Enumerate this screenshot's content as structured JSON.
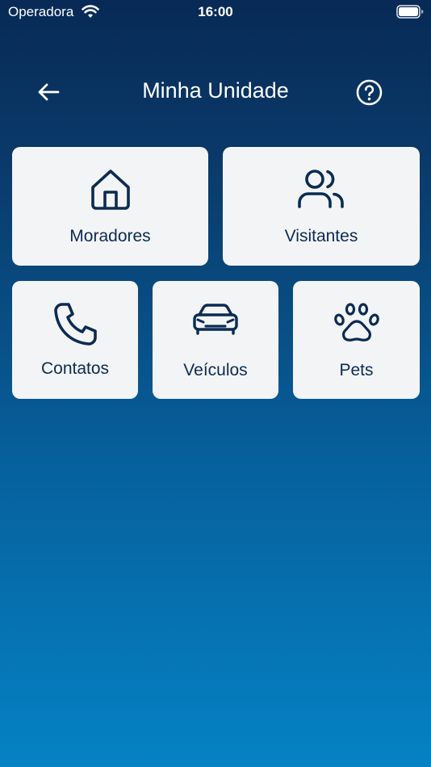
{
  "status_bar": {
    "carrier": "Operadora",
    "time": "16:00",
    "wifi_icon": "wifi-icon",
    "battery_icon": "battery-icon"
  },
  "header": {
    "title": "Minha Unidade",
    "back_icon": "arrow-left-icon",
    "help_icon": "question-circle-icon"
  },
  "menu": {
    "items": [
      {
        "label": "Moradores",
        "icon": "home-icon"
      },
      {
        "label": "Visitantes",
        "icon": "users-icon"
      },
      {
        "label": "Contatos",
        "icon": "phone-icon"
      },
      {
        "label": "Veículos",
        "icon": "car-icon"
      },
      {
        "label": "Pets",
        "icon": "paw-icon"
      }
    ]
  },
  "colors": {
    "background_top": "#082a55",
    "background_bottom": "#0582c4",
    "card_background": "#f3f4f6",
    "card_text": "#0b2b52",
    "header_text": "#ffffff"
  }
}
